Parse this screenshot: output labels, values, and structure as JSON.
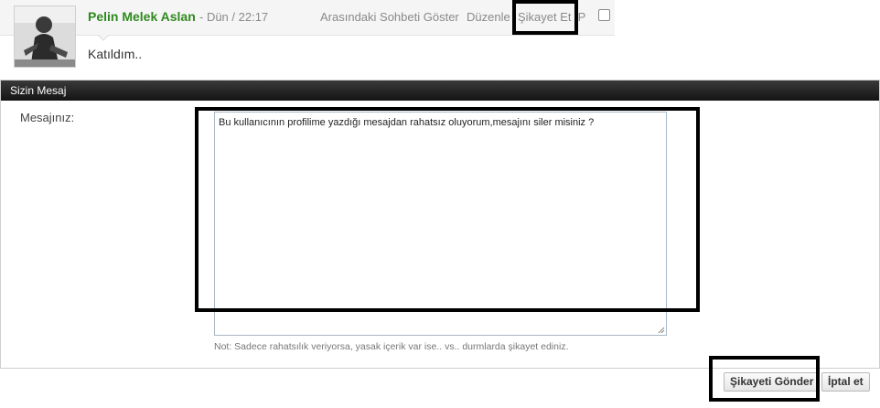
{
  "comment": {
    "author": "Pelin Melek Aslan",
    "date": "- Dün / 22:17",
    "actions": {
      "show_conversation": "Arasındaki Sohbeti Göster",
      "edit": "Düzenle",
      "report": "Şikayet Et",
      "ip": "IP"
    },
    "text": "Katıldım.."
  },
  "report_form": {
    "panel_title": "Sizin Mesaj",
    "message_label": "Mesajınız:",
    "message_value": "Bu kullanıcının profilime yazdığı mesajdan rahatsız oluyorum,mesajını siler misiniz ?",
    "note": "Not: Sadece rahatsılık veriyorsa, yasak içerik var ise.. vs.. durmlarda şikayet ediniz.",
    "submit_label": "Şikayeti Gönder",
    "cancel_label": "İptal et"
  }
}
